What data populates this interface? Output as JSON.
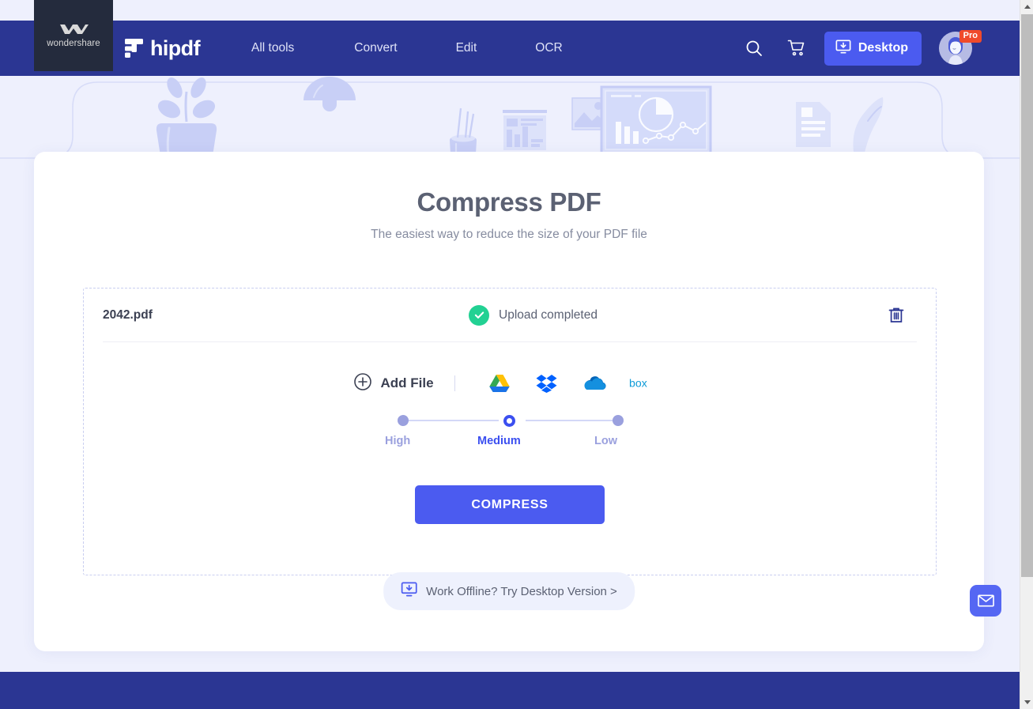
{
  "brand": {
    "vendor": "wondershare",
    "product": "hipdf"
  },
  "nav": {
    "items": [
      {
        "label": "All tools",
        "name": "nav-all-tools"
      },
      {
        "label": "Convert",
        "name": "nav-convert"
      },
      {
        "label": "Edit",
        "name": "nav-edit"
      },
      {
        "label": "OCR",
        "name": "nav-ocr"
      }
    ]
  },
  "header_right": {
    "search_icon": "search-icon",
    "cart_icon": "cart-icon",
    "desktop_label": "Desktop",
    "desktop_icon": "download-monitor-icon",
    "avatar_icon": "user-avatar",
    "pro_badge": "Pro"
  },
  "main": {
    "title": "Compress PDF",
    "subtitle": "The easiest way to reduce the size of your PDF file"
  },
  "file": {
    "name": "2042.pdf",
    "status": "Upload completed",
    "status_icon": "check-circle-icon",
    "delete_icon": "trash-icon"
  },
  "add_file": {
    "label": "Add File",
    "plus_icon": "plus-circle-icon",
    "cloud_services": [
      {
        "name": "google-drive-icon",
        "title": "Google Drive"
      },
      {
        "name": "dropbox-icon",
        "title": "Dropbox"
      },
      {
        "name": "onedrive-icon",
        "title": "OneDrive"
      },
      {
        "name": "box-icon",
        "title": "Box"
      }
    ]
  },
  "compression": {
    "options": [
      {
        "label": "High",
        "value": "high",
        "selected": false
      },
      {
        "label": "Medium",
        "value": "medium",
        "selected": true
      },
      {
        "label": "Low",
        "value": "low",
        "selected": false
      }
    ],
    "selected": "Medium"
  },
  "actions": {
    "compress_label": "COMPRESS",
    "offline_label": "Work Offline? Try Desktop Version >",
    "offline_icon": "download-monitor-icon",
    "mail_icon": "mail-icon"
  },
  "colors": {
    "header_blue": "#2b3693",
    "accent_blue": "#4b5bf0",
    "page_bg": "#eef0fd",
    "success_green": "#22d193",
    "pro_red": "#f04a2b",
    "slider_muted": "#9aa0de"
  },
  "scrollbar": {
    "up_arrow": "scroll-up-arrow",
    "down_arrow": "scroll-down-arrow"
  }
}
